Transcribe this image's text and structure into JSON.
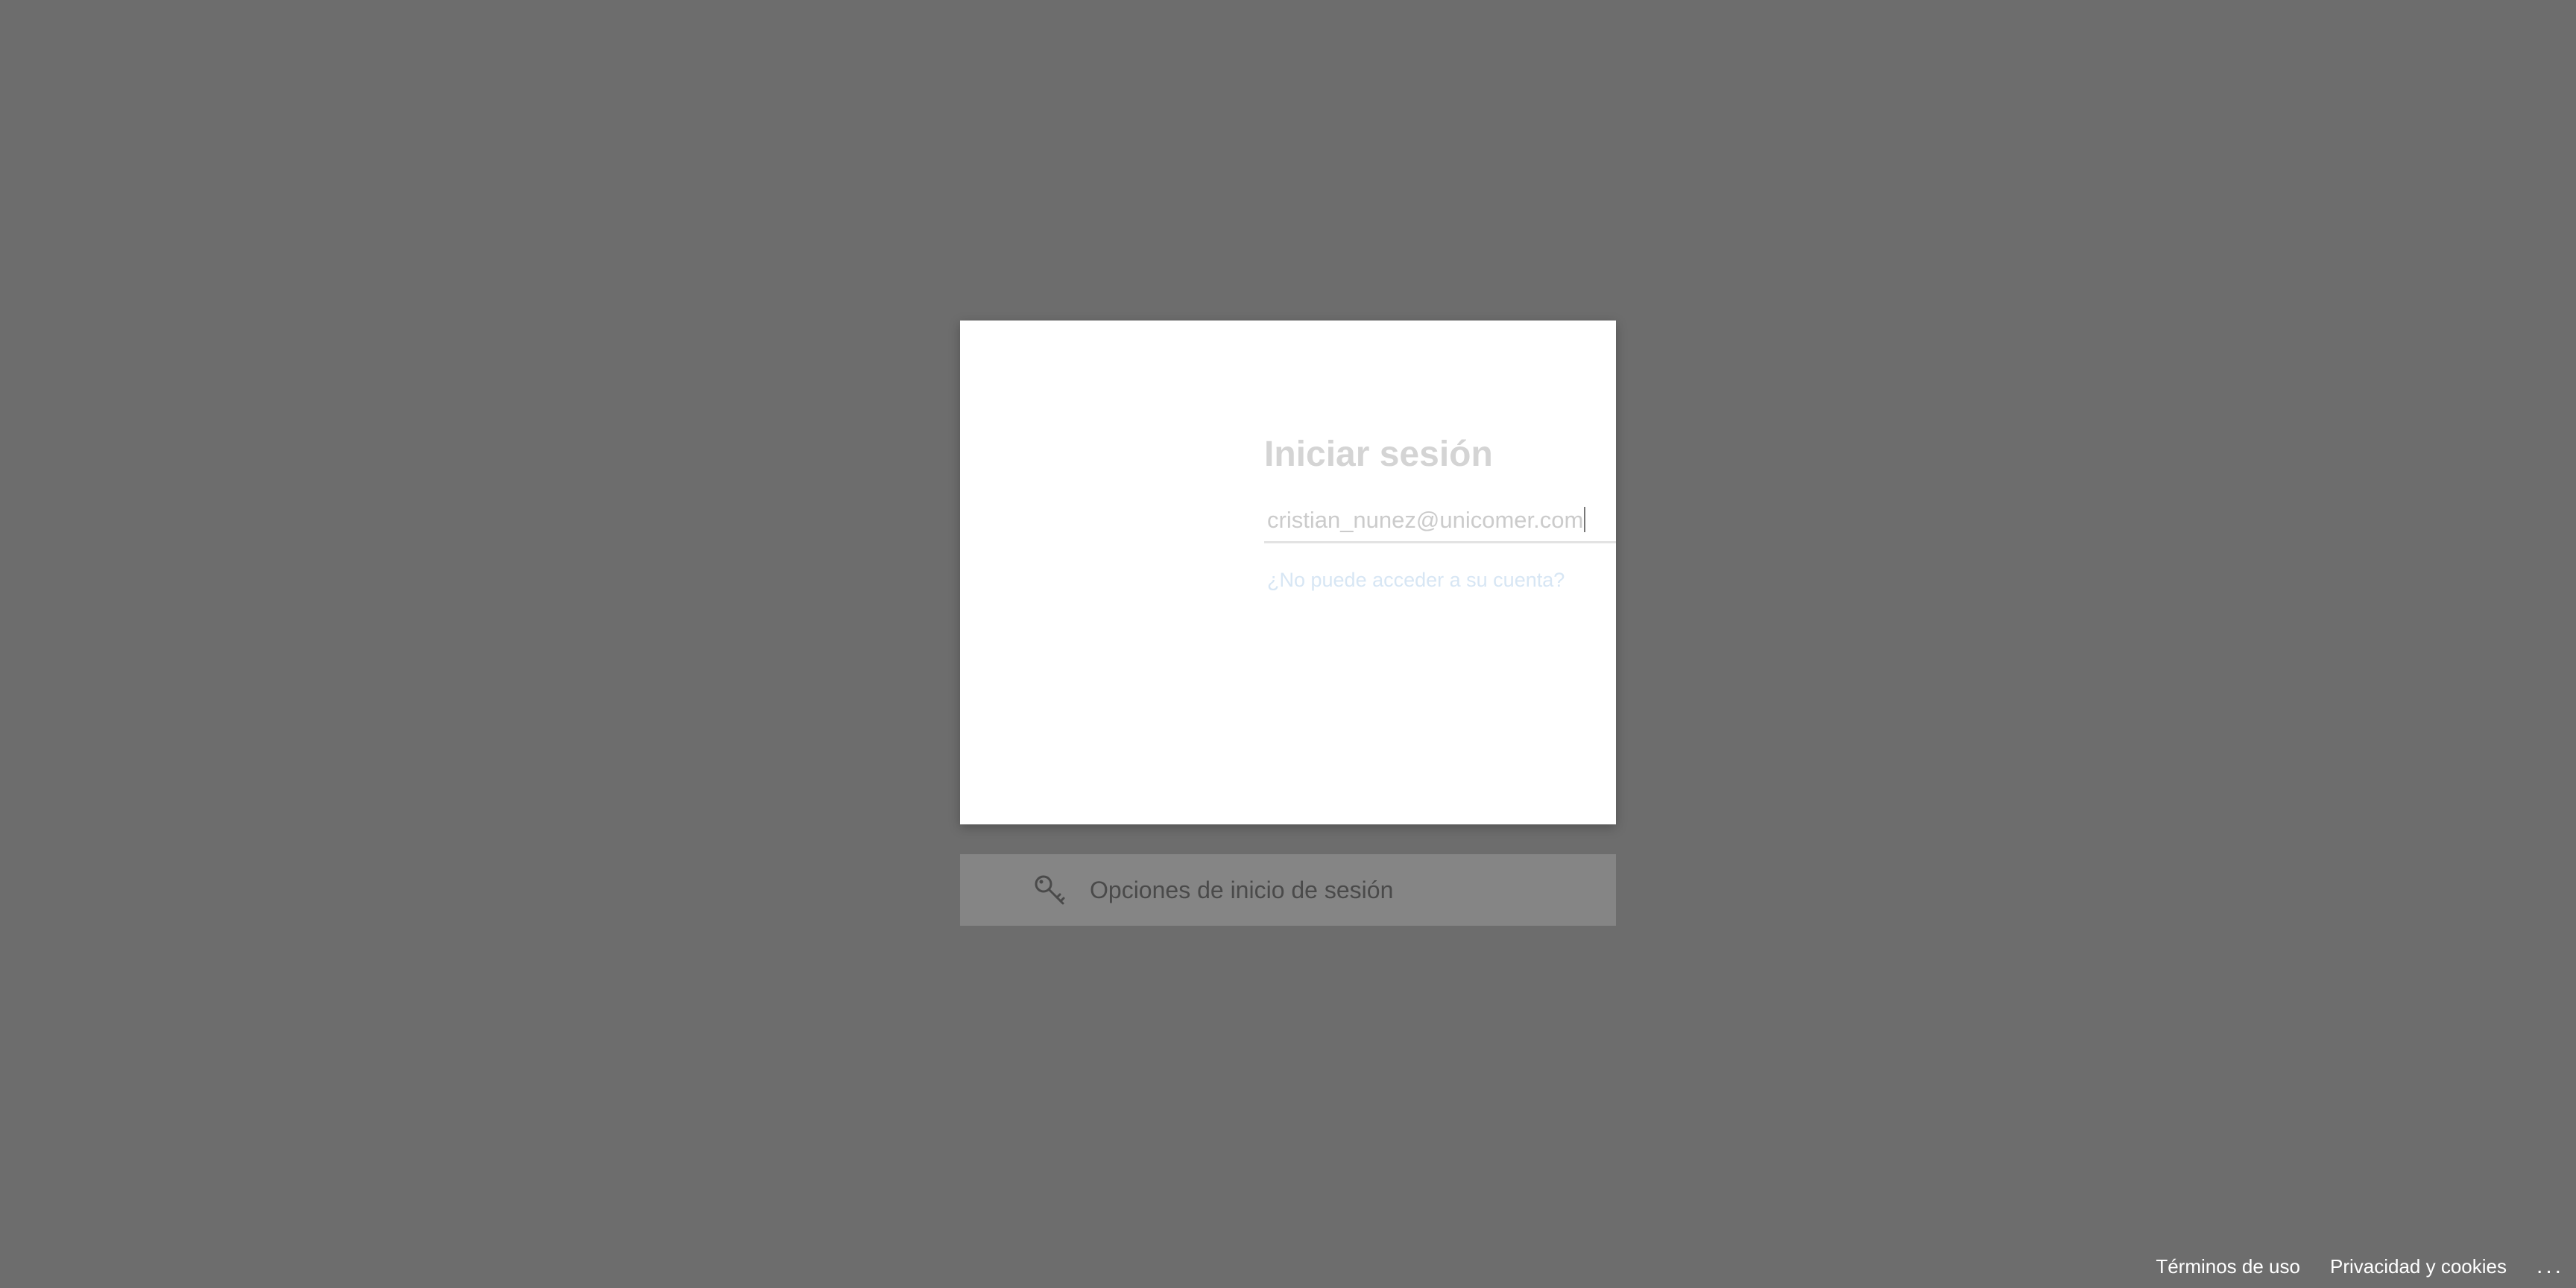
{
  "signin": {
    "title": "Iniciar sesión",
    "email_value": "cristian_nunez@unicomer.com",
    "forgot_link": "¿No puede acceder a su cuenta?"
  },
  "options": {
    "icon": "key-icon",
    "label": "Opciones de inicio de sesión"
  },
  "footer": {
    "terms": "Términos de uso",
    "privacy": "Privacidad y cookies",
    "more": "..."
  },
  "colors": {
    "backdrop": "#6d6d6d",
    "card": "#ffffff",
    "options_bar": "#858585"
  }
}
